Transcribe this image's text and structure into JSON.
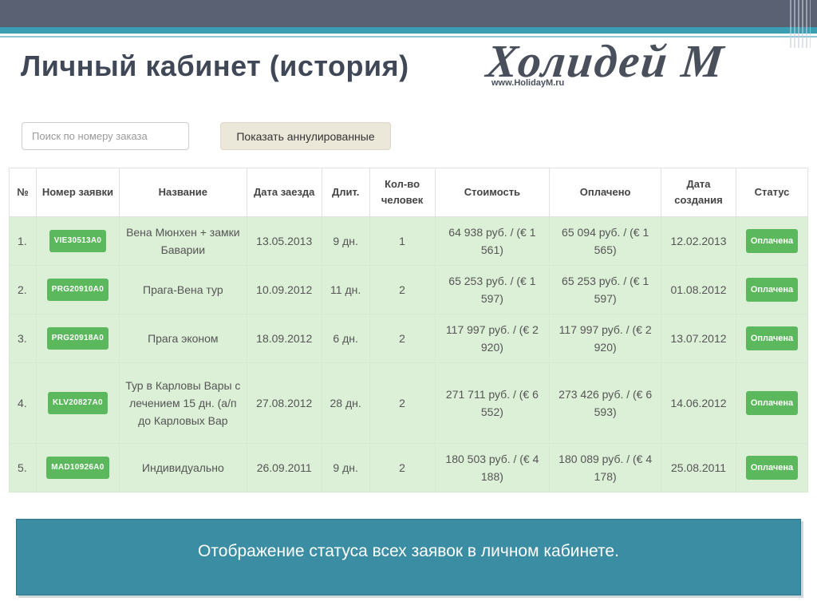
{
  "slide": {
    "title": "Личный кабинет (история)",
    "footer_text": "Отображение статуса всех заявок в личном кабинете."
  },
  "logo": {
    "name": "Холидей М",
    "url": "www.HolidayM.ru"
  },
  "search": {
    "placeholder": "Поиск по номеру заказа"
  },
  "toolbar": {
    "show_cancelled_label": "Показать аннулированные"
  },
  "table": {
    "headers": {
      "num": "№",
      "order_no": "Номер заявки",
      "name": "Название",
      "checkin": "Дата заезда",
      "duration": "Длит.",
      "persons": "Кол-во человек",
      "cost": "Стоимость",
      "paid": "Оплачено",
      "created": "Дата создания",
      "status": "Статус"
    },
    "rows": [
      {
        "num": "1.",
        "order_no": "VIE30513A0",
        "name": "Вена Мюнхен + замки Баварии",
        "checkin": "13.05.2013",
        "duration": "9 дн.",
        "persons": "1",
        "cost": "64 938 руб. / (€ 1 561)",
        "paid": "65 094 руб. / (€ 1 565)",
        "created": "12.02.2013",
        "status": "Оплачена"
      },
      {
        "num": "2.",
        "order_no": "PRG20910A0",
        "name": "Прага-Вена тур",
        "checkin": "10.09.2012",
        "duration": "11 дн.",
        "persons": "2",
        "cost": "65 253 руб. / (€ 1 597)",
        "paid": "65 253 руб. / (€ 1 597)",
        "created": "01.08.2012",
        "status": "Оплачена"
      },
      {
        "num": "3.",
        "order_no": "PRG20918A0",
        "name": "Прага эконом",
        "checkin": "18.09.2012",
        "duration": "6 дн.",
        "persons": "2",
        "cost": "117 997 руб. / (€ 2 920)",
        "paid": "117 997 руб. / (€ 2 920)",
        "created": "13.07.2012",
        "status": "Оплачена"
      },
      {
        "num": "4.",
        "order_no": "KLV20827A0",
        "name": "Тур в Карловы Вары с лечением 15 дн. (а/п до Карловых Вар",
        "checkin": "27.08.2012",
        "duration": "28 дн.",
        "persons": "2",
        "cost": "271 711 руб. / (€ 6 552)",
        "paid": "273 426 руб. / (€ 6 593)",
        "created": "14.06.2012",
        "status": "Оплачена"
      },
      {
        "num": "5.",
        "order_no": "MAD10926A0",
        "name": "Индивидуально",
        "checkin": "26.09.2011",
        "duration": "9 дн.",
        "persons": "2",
        "cost": "180 503 руб. / (€ 4 188)",
        "paid": "180 089 руб. / (€ 4 178)",
        "created": "25.08.2011",
        "status": "Оплачена"
      }
    ]
  },
  "colors": {
    "status_green": "#5cb85c",
    "row_bg": "#dcefd7",
    "footer_bg": "#3b8da3"
  }
}
